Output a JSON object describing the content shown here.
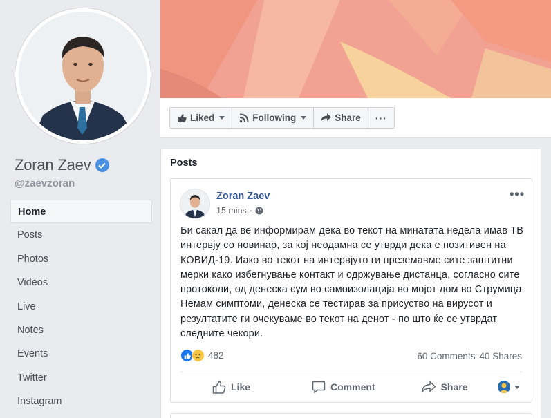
{
  "page": {
    "name": "Zoran Zaev",
    "handle": "@zaevzoran"
  },
  "nav": {
    "items": [
      "Home",
      "Posts",
      "Photos",
      "Videos",
      "Live",
      "Notes",
      "Events",
      "Twitter",
      "Instagram"
    ]
  },
  "actions": {
    "liked": "Liked",
    "following": "Following",
    "share": "Share",
    "more": "···"
  },
  "posts_section": {
    "title": "Posts"
  },
  "post": {
    "author": "Zoran Zaev",
    "time": "15 mins",
    "text": "Би сакал да ве информирам дека во текот на минатата недела имав ТВ интервју со новинар, за кој неодамна се утврди дека е позитивен на КОВИД-19. Иако во текот на интервјуто ги преземавме сите заштитни мерки како избегнување контакт и одржување дистанца, согласно сите протоколи, од денеска сум во самоизолација во мојот дом во Струмица. Немам симптоми, денеска се тестирав за присуство на вирусот и резултатите ги очекуваме во текот на денот - по што ќе се утврдат следните чекори.",
    "reaction_count": "482",
    "comments": "60 Comments",
    "shares": "40 Shares",
    "like_label": "Like",
    "comment_label": "Comment",
    "share_label": "Share",
    "more": "•••"
  },
  "colors": {
    "link": "#385898",
    "accent": "#4a90e2",
    "background": "#e9ebee"
  }
}
